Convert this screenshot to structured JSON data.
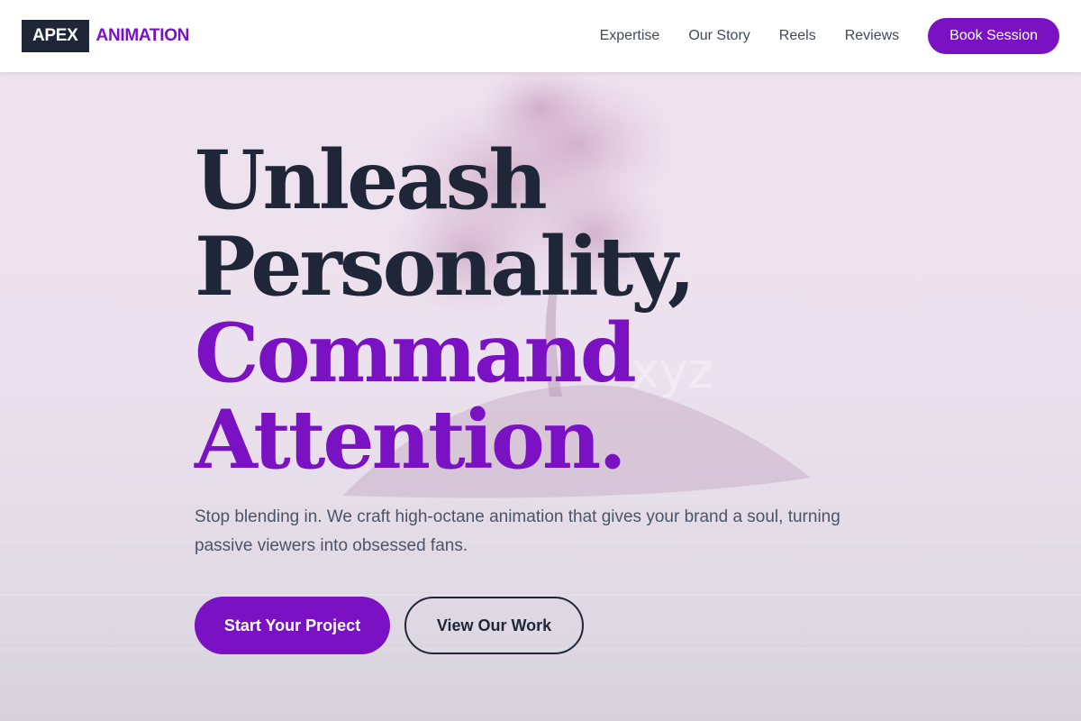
{
  "header": {
    "logo_box": "APEX",
    "logo_text": "ANIMATION",
    "nav": [
      {
        "label": "Expertise"
      },
      {
        "label": "Our Story"
      },
      {
        "label": "Reels"
      },
      {
        "label": "Reviews"
      }
    ],
    "cta_label": "Book Session"
  },
  "hero": {
    "headline": {
      "line1": "Unleash",
      "line2": "Personality,",
      "line3": "Command",
      "line4": "Attention."
    },
    "subtitle": "Stop blending in. We craft high-octane animation that gives your brand a soul, turning passive viewers into obsessed fans.",
    "primary_button": "Start Your Project",
    "secondary_button": "View Our Work",
    "watermark": "xyz"
  },
  "colors": {
    "accent": "#7a12c4",
    "dark": "#1e2638",
    "header_bg": "#ffffff",
    "text_muted": "#4b5466"
  },
  "icons": {
    "background_image": "tree-island-landscape-icon"
  }
}
